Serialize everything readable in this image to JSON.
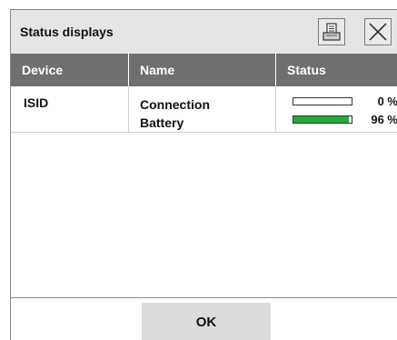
{
  "dialog": {
    "title": "Status displays",
    "print_icon": "printer-icon",
    "close_icon": "close-icon"
  },
  "table": {
    "headers": [
      "Device",
      "Name",
      "Status"
    ],
    "rows": [
      {
        "device": "ISID",
        "items": [
          {
            "name": "Connection",
            "percent_label": "0 %",
            "fraction": 0.0
          },
          {
            "name": "Battery",
            "percent_label": "96 %",
            "fraction": 0.96
          }
        ]
      }
    ]
  },
  "ok_label": "OK",
  "colors": {
    "header_bg": "#6f6f6f",
    "bar_fill": "#22aa3a"
  }
}
